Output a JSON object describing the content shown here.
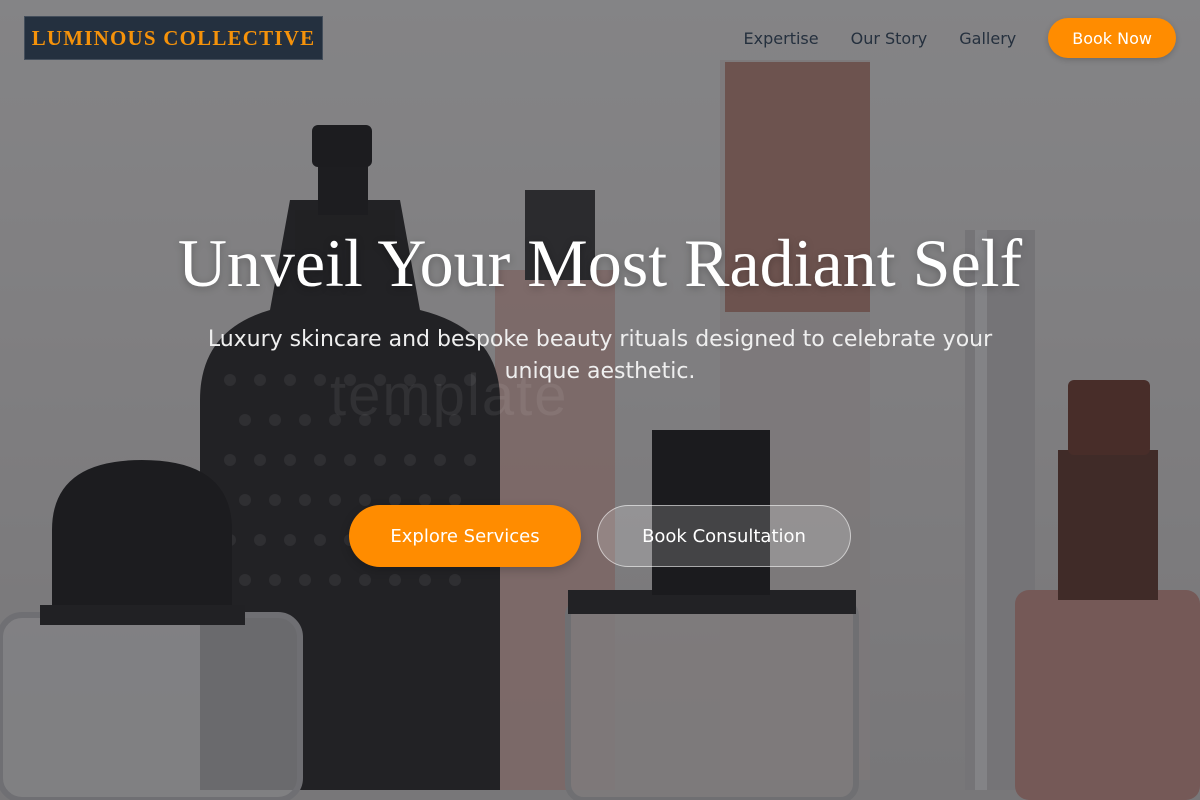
{
  "brand": {
    "name": "LUMINOUS COLLECTIVE"
  },
  "nav": {
    "links": [
      "Expertise",
      "Our Story",
      "Gallery"
    ],
    "cta_label": "Book Now"
  },
  "hero": {
    "title": "Unveil Your Most Radiant Self",
    "subtitle": "Luxury skincare and bespoke beauty rituals designed to celebrate your unique aesthetic.",
    "primary_label": "Explore Services",
    "secondary_label": "Book Consultation"
  },
  "background": {
    "watermark_text": "template"
  },
  "colors": {
    "accent": "#ff8c00",
    "logo_bg": "#24303f",
    "logo_text": "#f5920a",
    "nav_text": "#25303e"
  }
}
